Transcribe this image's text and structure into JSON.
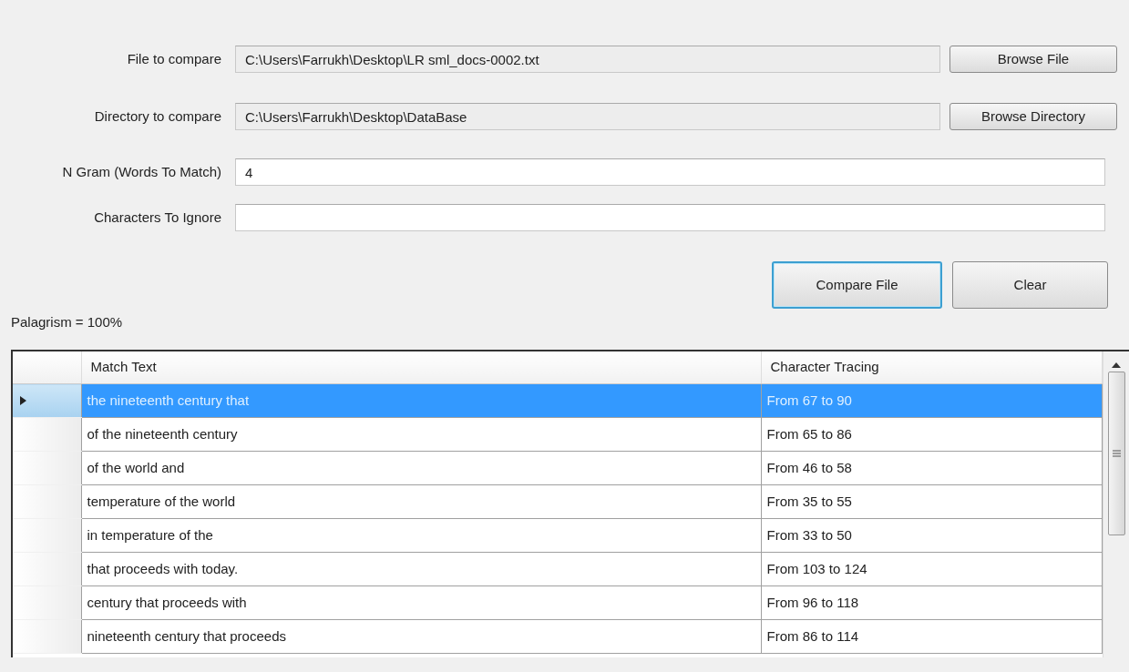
{
  "fields": [
    {
      "label": "File to compare",
      "value": "C:\\Users\\Farrukh\\Desktop\\LR sml_docs-0002.txt",
      "readonly": true,
      "button": "Browse File"
    },
    {
      "label": "Directory to compare",
      "value": "C:\\Users\\Farrukh\\Desktop\\DataBase",
      "readonly": true,
      "button": "Browse Directory"
    },
    {
      "label": "N Gram (Words To Match)",
      "value": "4",
      "readonly": false
    },
    {
      "label": "Characters To Ignore",
      "readonly": false
    }
  ],
  "actions": [
    {
      "label": "Compare File",
      "focused": true
    },
    {
      "label": "Clear",
      "focused": false
    }
  ],
  "result": "Palagrism = 100%",
  "table": {
    "columns": [
      "Match Text",
      "Character Tracing"
    ],
    "rows": [
      {
        "cells": [
          "the nineteenth century that",
          "From 67 to 90"
        ],
        "selected": true
      },
      {
        "cells": [
          "of the nineteenth century",
          "From 65 to 86"
        ],
        "selected": false
      },
      {
        "cells": [
          "of the world and",
          "From 46 to 58"
        ],
        "selected": false
      },
      {
        "cells": [
          "temperature of the world",
          "From 35 to 55"
        ],
        "selected": false
      },
      {
        "cells": [
          "in temperature of the",
          "From 33 to 50"
        ],
        "selected": false
      },
      {
        "cells": [
          "that proceeds with today.",
          "From 103 to 124"
        ],
        "selected": false
      },
      {
        "cells": [
          "century that proceeds with",
          "From 96 to 118"
        ],
        "selected": false
      },
      {
        "cells": [
          "nineteenth century that proceeds",
          "From 86 to 114"
        ],
        "selected": false
      }
    ]
  }
}
